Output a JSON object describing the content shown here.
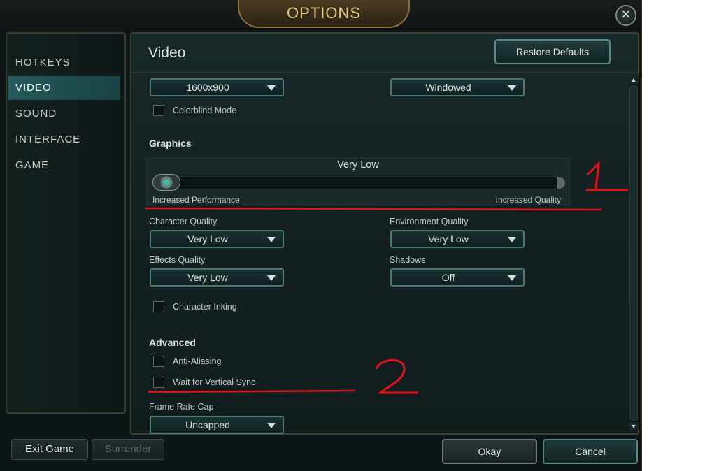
{
  "window": {
    "title": "OPTIONS",
    "close_label": "✕"
  },
  "sidebar": {
    "items": [
      {
        "label": "HOTKEYS"
      },
      {
        "label": "VIDEO"
      },
      {
        "label": "SOUND"
      },
      {
        "label": "INTERFACE"
      },
      {
        "label": "GAME"
      }
    ],
    "active_index": 1
  },
  "header": {
    "title": "Video",
    "restore_label": "Restore Defaults"
  },
  "resolution": {
    "value": "1600x900"
  },
  "window_mode": {
    "value": "Windowed"
  },
  "colorblind": {
    "label": "Colorblind Mode",
    "checked": false
  },
  "graphics": {
    "heading": "Graphics",
    "preset": "Very Low",
    "left_label": "Increased Performance",
    "right_label": "Increased Quality",
    "level_fraction": 0.0
  },
  "character_quality": {
    "label": "Character Quality",
    "value": "Very Low"
  },
  "environment_quality": {
    "label": "Environment Quality",
    "value": "Very Low"
  },
  "effects_quality": {
    "label": "Effects Quality",
    "value": "Very Low"
  },
  "shadows": {
    "label": "Shadows",
    "value": "Off"
  },
  "character_inking": {
    "label": "Character Inking",
    "checked": false
  },
  "advanced": {
    "heading": "Advanced",
    "anti_aliasing": {
      "label": "Anti-Aliasing",
      "checked": false
    },
    "vsync": {
      "label": "Wait for Vertical Sync",
      "checked": false
    },
    "frame_rate_cap": {
      "label": "Frame Rate Cap",
      "value": "Uncapped"
    }
  },
  "footer": {
    "exit_label": "Exit Game",
    "surrender_label": "Surrender",
    "okay_label": "Okay",
    "cancel_label": "Cancel"
  },
  "annotations": {
    "mark_1": "1",
    "mark_2": "2",
    "color": "#e0141e"
  },
  "colors": {
    "accent": "#265a5c",
    "title_gold": "#e6c883"
  }
}
